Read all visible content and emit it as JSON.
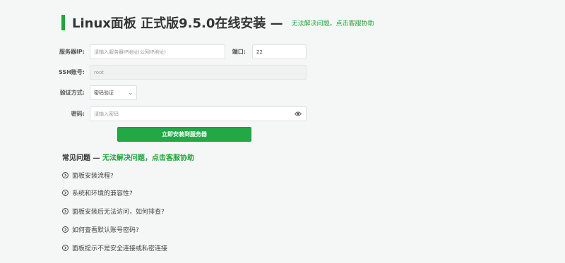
{
  "header": {
    "title": "Linux面板 正式版9.5.0在线安装 —",
    "help_link": "无法解决问题，点击客服协助"
  },
  "form": {
    "server_ip": {
      "label": "服务器IP:",
      "placeholder": "请输入服务器IP地址(公网IP地址)"
    },
    "port": {
      "label": "端口:",
      "value": "22"
    },
    "ssh_account": {
      "label": "SSH账号:",
      "value": "root"
    },
    "auth_method": {
      "label": "验证方式:",
      "selected": "密码验证"
    },
    "password": {
      "label": "密码:",
      "placeholder": "请输入密码"
    },
    "install_button": "立即安装到服务器"
  },
  "faq": {
    "heading": "常见问题 —",
    "heading_link": "无法解决问题，点击客服协助",
    "items": [
      "面板安装流程?",
      "系统和环境的兼容性?",
      "面板安装后无法访问，如何排查?",
      "如何查看默认账号密码?",
      "面板提示不是安全连接或私密连接"
    ]
  },
  "colors": {
    "accent": "#20a53a",
    "button": "#22a845",
    "background": "#f5f7f6"
  }
}
